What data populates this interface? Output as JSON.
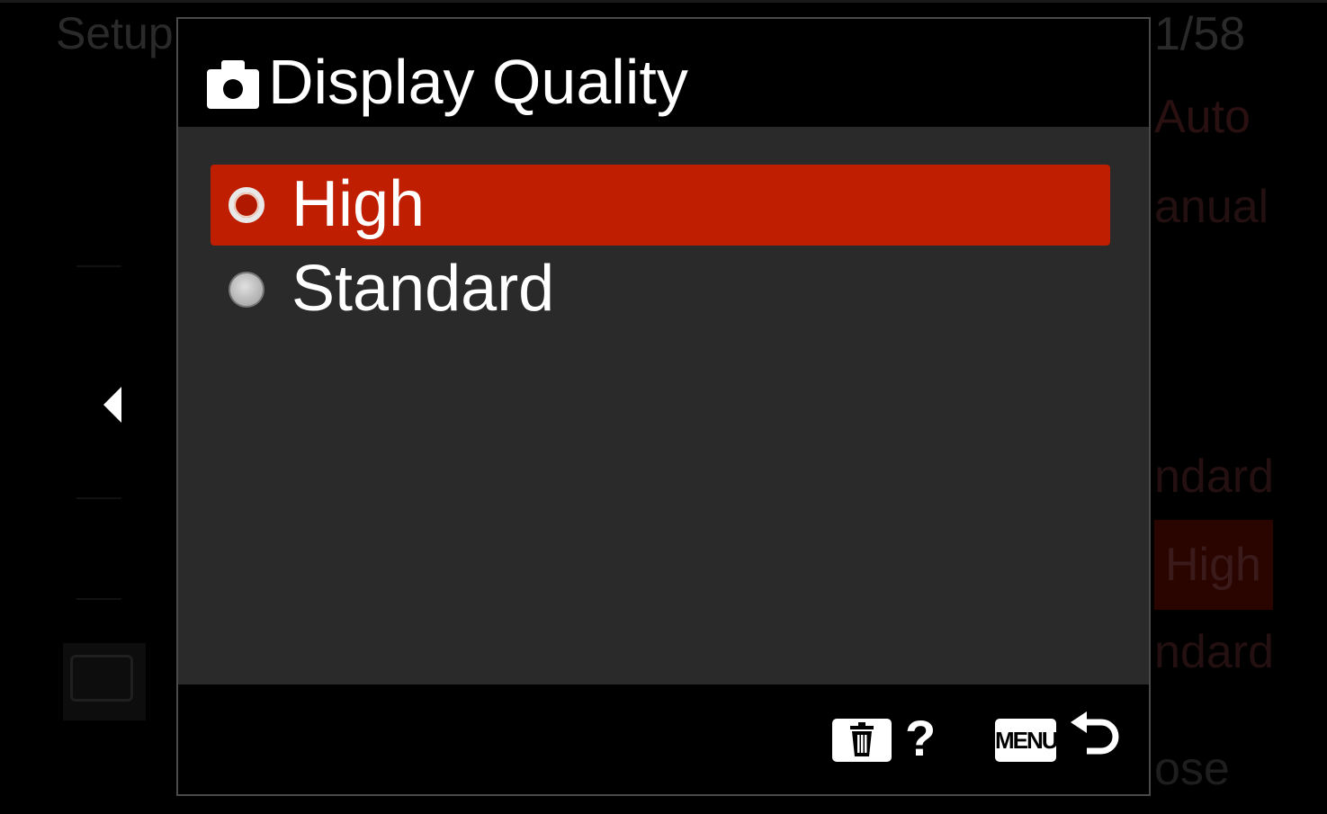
{
  "background_menu": {
    "title": "Setup",
    "page": "1/58",
    "values": [
      "Auto",
      "anual",
      "ndard",
      "High",
      "ndard"
    ],
    "close_hint": "ose"
  },
  "dialog": {
    "title": "Display Quality",
    "header_icon": "camera-icon",
    "options": [
      {
        "label": "High",
        "selected": true
      },
      {
        "label": "Standard",
        "selected": false
      }
    ],
    "footer": {
      "delete_icon": "trash-icon",
      "help_label": "?",
      "menu_key_label": "MENU",
      "back_icon": "return-arrow-icon"
    }
  },
  "colors": {
    "selection": "#c01e00",
    "dialog_body": "#2a2a2a",
    "background": "#000000"
  }
}
